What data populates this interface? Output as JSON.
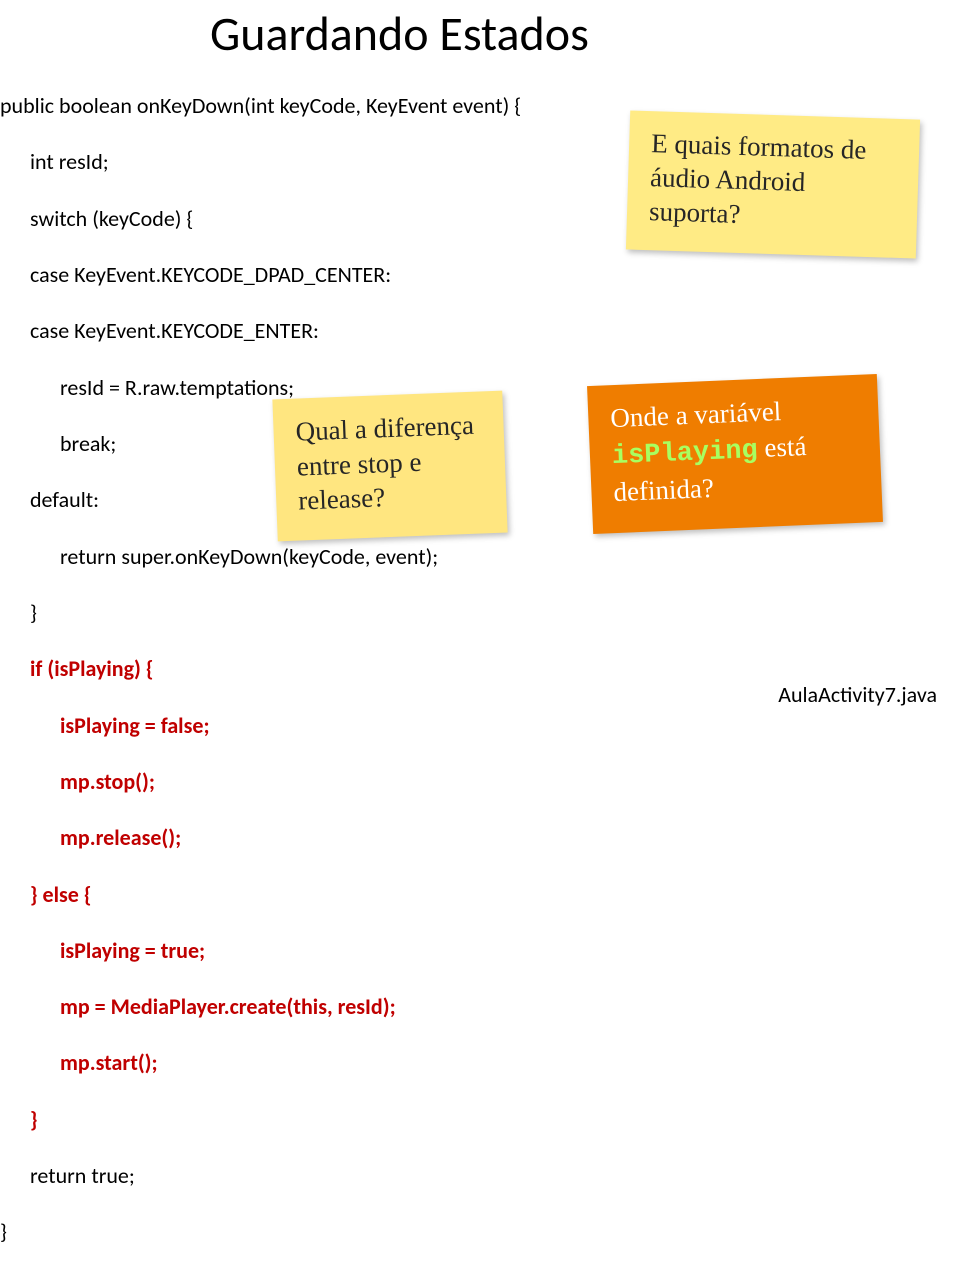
{
  "title": "Guardando Estados",
  "code": {
    "l1": "public boolean onKeyDown(int keyCode, KeyEvent event) {",
    "l2": "int resId;",
    "l3": "switch (keyCode) {",
    "l4": "case KeyEvent.KEYCODE_DPAD_CENTER:",
    "l5": "case KeyEvent.KEYCODE_ENTER:",
    "l6": "resId = R.raw.temptations;",
    "l7": "break;",
    "l8": "default:",
    "l9": "return super.onKeyDown(keyCode, event);",
    "l10": "}",
    "l11": "if (isPlaying) {",
    "l12": "isPlaying = false;",
    "l13": "mp.stop();",
    "l14": "mp.release();",
    "l15": "} else {",
    "l16": "isPlaying = true;",
    "l17": "mp = MediaPlayer.create(this, resId);",
    "l18": "mp.start();",
    "l19": "}",
    "l20": "return true;",
    "l21": "}"
  },
  "sticky_top": "E quais formatos de áudio Android suporta?",
  "sticky_mid": "Qual a diferença entre stop e release?",
  "sticky_orange_pre": "Onde a variável ",
  "sticky_orange_code": "isPlaying",
  "sticky_orange_post": " está definida?",
  "footer_file": "AulaActivity7.java"
}
